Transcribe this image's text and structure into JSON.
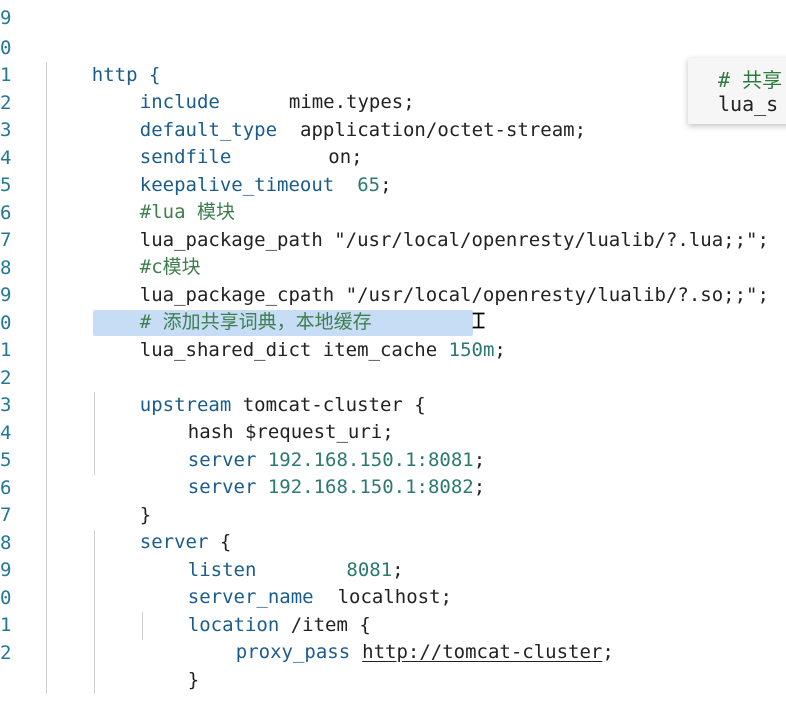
{
  "gutter": [
    "9",
    "0",
    "1",
    "2",
    "3",
    "4",
    "5",
    "6",
    "7",
    "8",
    "9",
    "0",
    "1",
    "2",
    "3",
    "4",
    "5",
    "6",
    "7",
    "8",
    "9",
    "0",
    "1",
    "2"
  ],
  "lines": {
    "l0": {
      "a": "http {"
    },
    "l1": {
      "k": "include",
      "v": "mime.types;"
    },
    "l2": {
      "k": "default_type",
      "v": "application/octet-stream;"
    },
    "l3": {
      "k": "sendfile",
      "v": "on;"
    },
    "l4": {
      "k": "keepalive_timeout",
      "n": "65",
      "e": ";"
    },
    "l5": {
      "c": "#lua 模块"
    },
    "l6": {
      "p": "lua_package_path \"/usr/local/openresty/lualib/?.lua;;\";"
    },
    "l7": {
      "c": "#c模块"
    },
    "l8": {
      "p": "lua_package_cpath \"/usr/local/openresty/lualib/?.so;;\";"
    },
    "l9": {
      "c": "# 添加共享词典，本地缓存"
    },
    "l10": {
      "a": "lua_shared_dict item_cache ",
      "n": "150m",
      "e": ";"
    },
    "l12": {
      "k": "upstream",
      "v": " tomcat-cluster {"
    },
    "l13": {
      "p": "hash $request_uri;"
    },
    "l14": {
      "k": "server",
      "n": " 192.168.150.1:8081",
      "e": ";"
    },
    "l15": {
      "k": "server",
      "n": " 192.168.150.1:8082",
      "e": ";"
    },
    "l16": {
      "p": "}"
    },
    "l17": {
      "k": "server",
      "v": " {"
    },
    "l18": {
      "k": "listen",
      "n": "8081",
      "e": ";"
    },
    "l19": {
      "k": "server_name",
      "v": "localhost;"
    },
    "l20": {
      "k": "location",
      "v": " /item {"
    },
    "l21": {
      "k": "proxy_pass",
      "u": "http://tomcat-cluster",
      "e": ";"
    },
    "l22": {
      "p": "}"
    }
  },
  "tooltip": {
    "line1": "# 共享",
    "line2": "lua_s"
  }
}
